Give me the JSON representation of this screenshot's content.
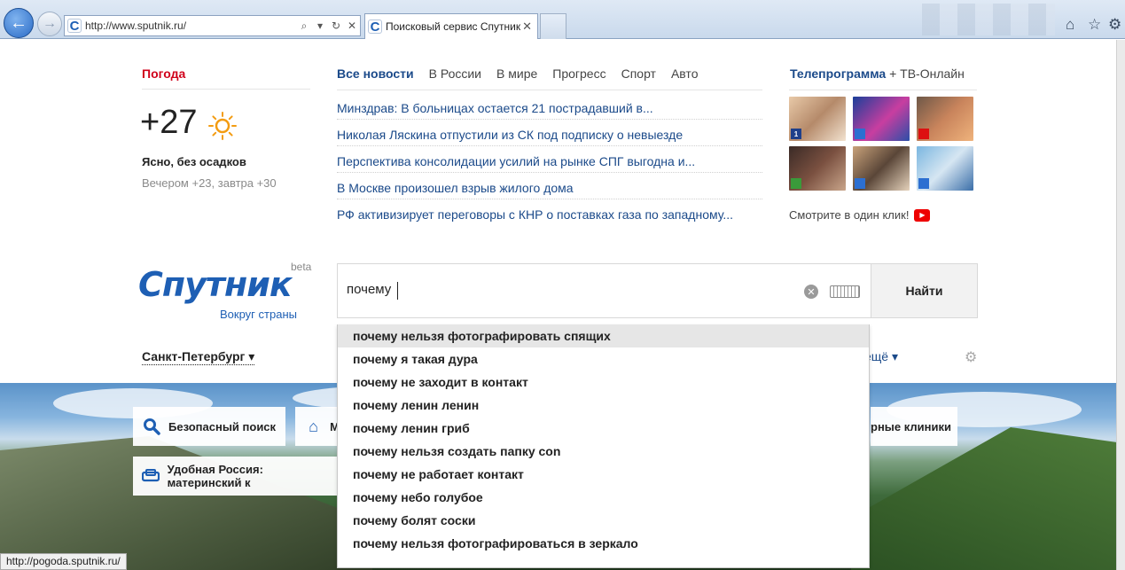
{
  "browser": {
    "address": "http://www.sputnik.ru/",
    "tab_title": "Поисковый сервис Спутник",
    "favicon_letter": "C"
  },
  "weather": {
    "title": "Погода",
    "temperature": "+27",
    "description": "Ясно, без осадков",
    "forecast": "Вечером +23, завтра +30"
  },
  "news": {
    "tabs": [
      "Все новости",
      "В России",
      "В мире",
      "Прогресс",
      "Спорт",
      "Авто"
    ],
    "items": [
      "Минздрав: В больницах остается 21 пострадавший в...",
      "Николая Ляскина отпустили из СК под подписку о невыезде",
      "Перспектива консолидации усилий на рынке СПГ выгодна и...",
      "В Москве произошел взрыв жилого дома",
      "РФ активизирует переговоры с КНР о поставках газа по западному..."
    ]
  },
  "tv": {
    "title_bold": "Телепрограмма",
    "title_rest": " + ТВ-Онлайн",
    "note": "Смотрите в один клик!"
  },
  "logo": {
    "name": "Спутник",
    "beta": "beta",
    "tagline": "Вокруг страны"
  },
  "search": {
    "query": "почему",
    "button": "Найти",
    "suggestions": [
      "почему нельзя фотографировать спящих",
      "почему я такая дура",
      "почему не заходит в контакт",
      "почему ленин ленин",
      "почему ленин гриб",
      "почему нельзя создать папку con",
      "почему не работает контакт",
      "почему небо голубое",
      "почему болят соски",
      "почему нельзя фотографироваться в зеркало"
    ]
  },
  "location": {
    "city": "Санкт-Петербург",
    "more": "ещё"
  },
  "quick_links": {
    "safe_search": "Безопасный поиск",
    "home_partial": "М",
    "clinics_partial": "рные клиники",
    "russia_partial": "Удобная Россия: материнский к"
  },
  "status_bar": "http://pogoda.sputnik.ru/"
}
